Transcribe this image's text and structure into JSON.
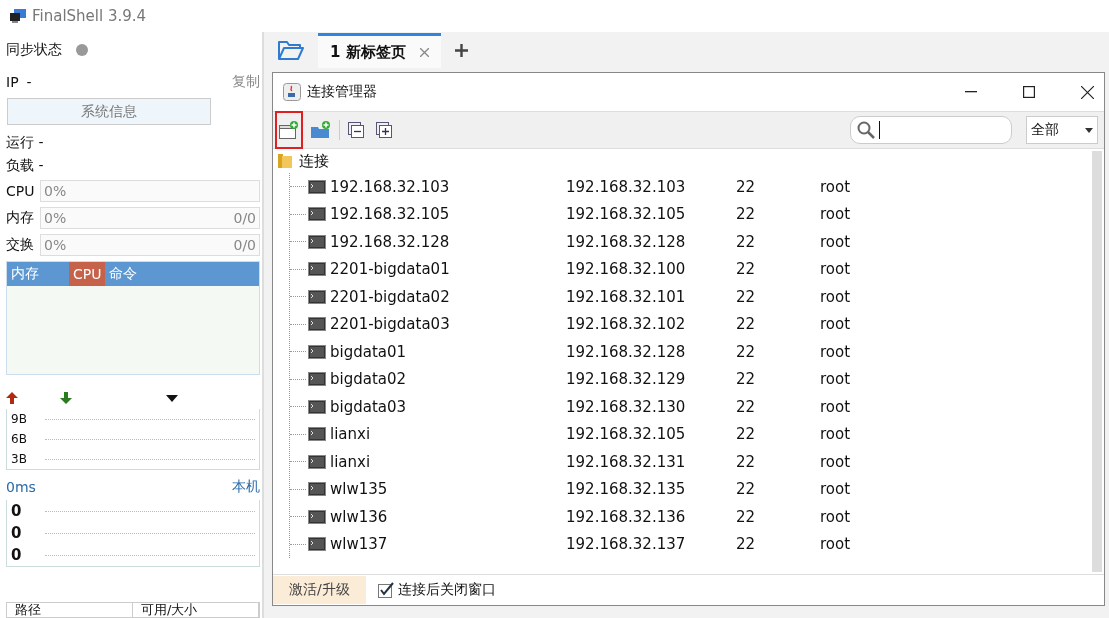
{
  "window": {
    "title": "FinalShell 3.9.4"
  },
  "sidebar": {
    "sync_label": "同步状态",
    "ip_label": "IP",
    "ip_value": "-",
    "copy": "复制",
    "sysinfo_button": "系统信息",
    "uptime": "运行 -",
    "load": "负载 -",
    "meters": [
      {
        "label": "CPU",
        "value": "0%",
        "level": 0
      },
      {
        "label": "内存",
        "value": "0%",
        "total": "0/0",
        "level": 0
      },
      {
        "label": "交换",
        "value": "0%",
        "total": "0/0",
        "level": 0
      }
    ],
    "process_tabs": [
      {
        "label": "内存",
        "selected": false
      },
      {
        "label": "CPU",
        "selected": true
      },
      {
        "label": "命令",
        "selected": false
      }
    ],
    "net_labels": [
      "9B",
      "6B",
      "3B"
    ],
    "ping": {
      "latency": "0ms",
      "host": "本机",
      "values": [
        "0",
        "0",
        "0"
      ]
    },
    "disk_columns": [
      "路径",
      "可用/大小"
    ]
  },
  "tabs": [
    {
      "label": "1 新标签页",
      "selected": true
    }
  ],
  "dialog": {
    "title": "连接管理器",
    "toolbar": [
      {
        "kind": "new-connection",
        "highlighted": true
      },
      {
        "kind": "new-folder",
        "highlighted": false
      },
      {
        "kind": "collapse",
        "highlighted": false
      },
      {
        "kind": "expand",
        "highlighted": false
      }
    ],
    "filter": "全部",
    "tree": {
      "label": "连接",
      "children": [
        {
          "name": "192.168.32.103",
          "host": "192.168.32.103",
          "port": "22",
          "user": "root"
        },
        {
          "name": "192.168.32.105",
          "host": "192.168.32.105",
          "port": "22",
          "user": "root"
        },
        {
          "name": "192.168.32.128",
          "host": "192.168.32.128",
          "port": "22",
          "user": "root"
        },
        {
          "name": "2201-bigdata01",
          "host": "192.168.32.100",
          "port": "22",
          "user": "root"
        },
        {
          "name": "2201-bigdata02",
          "host": "192.168.32.101",
          "port": "22",
          "user": "root"
        },
        {
          "name": "2201-bigdata03",
          "host": "192.168.32.102",
          "port": "22",
          "user": "root"
        },
        {
          "name": "bigdata01",
          "host": "192.168.32.128",
          "port": "22",
          "user": "root"
        },
        {
          "name": "bigdata02",
          "host": "192.168.32.129",
          "port": "22",
          "user": "root"
        },
        {
          "name": "bigdata03",
          "host": "192.168.32.130",
          "port": "22",
          "user": "root"
        },
        {
          "name": "lianxi",
          "host": "192.168.32.105",
          "port": "22",
          "user": "root"
        },
        {
          "name": "lianxi",
          "host": "192.168.32.131",
          "port": "22",
          "user": "root"
        },
        {
          "name": "wlw135",
          "host": "192.168.32.135",
          "port": "22",
          "user": "root"
        },
        {
          "name": "wlw136",
          "host": "192.168.32.136",
          "port": "22",
          "user": "root"
        },
        {
          "name": "wlw137",
          "host": "192.168.32.137",
          "port": "22",
          "user": "root"
        }
      ]
    },
    "activate": "激活/升级",
    "close_after": {
      "label": "连接后关闭窗口",
      "checked": true
    }
  }
}
